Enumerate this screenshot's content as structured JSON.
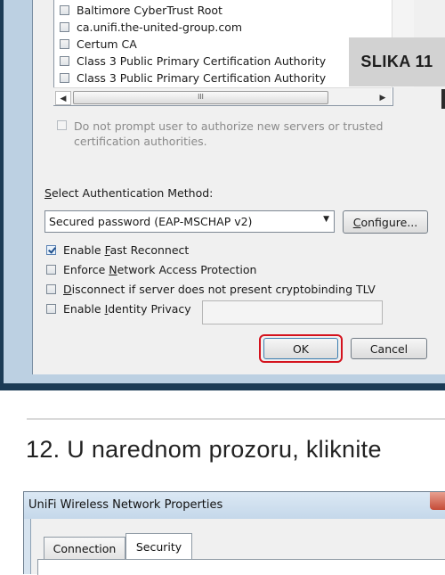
{
  "certificate_list": {
    "items": [
      {
        "label": "Baltimore CyberTrust Root",
        "checked": false
      },
      {
        "label": "ca.unifi.the-united-group.com",
        "checked": false
      },
      {
        "label": "Certum CA",
        "checked": false
      },
      {
        "label": "Class 3 Public Primary Certification Authority",
        "checked": false
      },
      {
        "label": "Class 3 Public Primary Certification Authority",
        "checked": false
      }
    ],
    "scroll_thumb_glyph": "III"
  },
  "caption_overlay": "SLIKA 11",
  "prompt_option": {
    "line1": "Do not prompt user to authorize new servers or trusted",
    "line2": "certification authorities.",
    "checked": false,
    "enabled": false
  },
  "auth_method": {
    "label_prefix": "S",
    "label_rest": "elect Authentication Method:",
    "selected": "Secured password (EAP-MSCHAP v2)",
    "configure_prefix": "C",
    "configure_rest": "onfigure..."
  },
  "options": [
    {
      "pre": "Enable ",
      "key": "F",
      "post": "ast Reconnect",
      "checked": true
    },
    {
      "pre": "Enforce ",
      "key": "N",
      "post": "etwork Access Protection",
      "checked": false
    },
    {
      "pre": "",
      "key": "D",
      "post": "isconnect if server does not present cryptobinding TLV",
      "checked": false
    },
    {
      "pre": "Enable ",
      "key": "I",
      "post": "dentity Privacy",
      "checked": false
    }
  ],
  "buttons": {
    "ok": "OK",
    "cancel": "Cancel"
  },
  "instruction": "12. U narednom prozoru, kliknite",
  "window": {
    "title": "UniFi Wireless Network Properties",
    "tabs": [
      {
        "label": "Connection",
        "active": false
      },
      {
        "label": "Security",
        "active": true
      }
    ]
  },
  "colors": {
    "highlight_outline": "#d4131e",
    "frame": "#1c3b55"
  }
}
